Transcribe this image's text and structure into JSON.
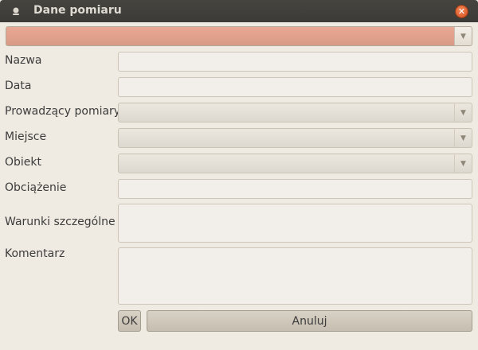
{
  "window": {
    "title": "Dane pomiaru"
  },
  "top_combo": {
    "value": ""
  },
  "form": {
    "name_label": "Nazwa",
    "date_label": "Data",
    "operator_label": "Prowadzący pomiary",
    "place_label": "Miejsce",
    "object_label": "Obiekt",
    "load_label": "Obciążenie",
    "conditions_label": "Warunki szczególne",
    "comment_label": "Komentarz"
  },
  "buttons": {
    "ok_label": "OK",
    "cancel_label": "Anuluj"
  },
  "icons": {
    "title": "window-menu-icon",
    "close": "close-icon",
    "dropdown": "dropdown-arrow-icon"
  },
  "colors": {
    "titlebar": "#3c3b37",
    "window_bg": "#f0ebe2",
    "close_button": "#e05a22",
    "selected_combo": "#e2a38e"
  }
}
